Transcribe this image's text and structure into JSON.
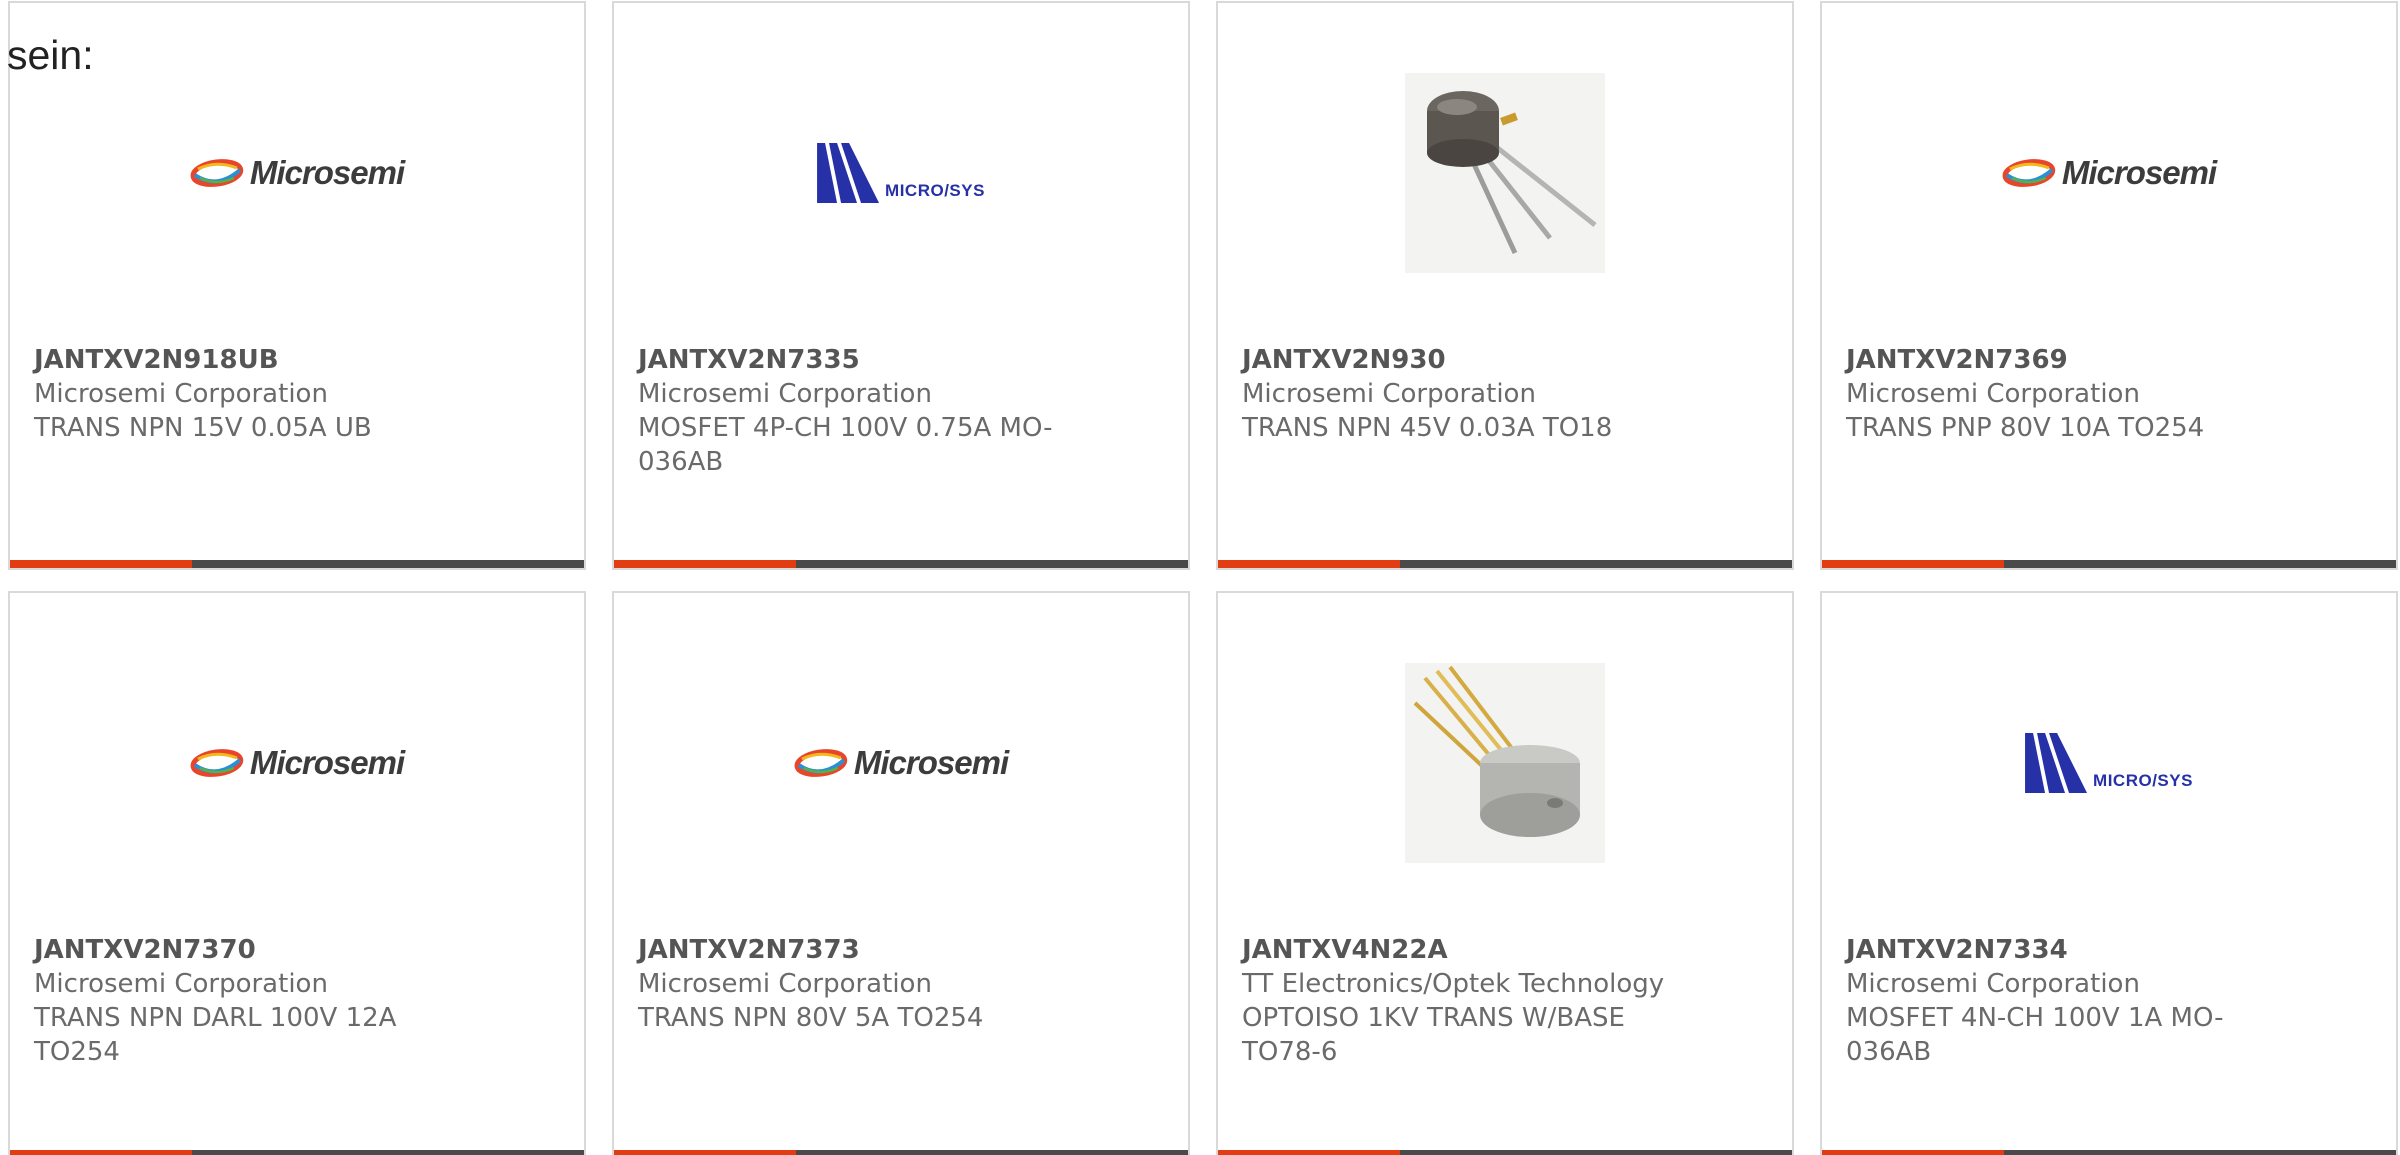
{
  "intro_text": "sein:",
  "colors": {
    "accent": "#e23d12",
    "bar": "#4a4a4a",
    "border": "#d9d9d9",
    "text": "#6a6a6a",
    "microsys_blue": "#2631a8"
  },
  "products": [
    {
      "part_number": "JANTXV2N918UB",
      "manufacturer": "Microsemi Corporation",
      "description": "TRANS NPN 15V 0.05A UB",
      "image": "microsemi-logo",
      "logo_text": "Microsemi"
    },
    {
      "part_number": "JANTXV2N7335",
      "manufacturer": "Microsemi Corporation",
      "description": "MOSFET 4P-CH 100V 0.75A MO-036AB",
      "image": "microsys-logo",
      "logo_text": "MICRO/SYS"
    },
    {
      "part_number": "JANTXV2N930",
      "manufacturer": "Microsemi Corporation",
      "description": "TRANS NPN 45V 0.03A TO18",
      "image": "to18-transistor-photo",
      "logo_text": ""
    },
    {
      "part_number": "JANTXV2N7369",
      "manufacturer": "Microsemi Corporation",
      "description": "TRANS PNP 80V 10A TO254",
      "image": "microsemi-logo",
      "logo_text": "Microsemi"
    },
    {
      "part_number": "JANTXV2N7370",
      "manufacturer": "Microsemi Corporation",
      "description": "TRANS NPN DARL 100V 12A TO254",
      "image": "microsemi-logo",
      "logo_text": "Microsemi"
    },
    {
      "part_number": "JANTXV2N7373",
      "manufacturer": "Microsemi Corporation",
      "description": "TRANS NPN 80V 5A TO254",
      "image": "microsemi-logo",
      "logo_text": "Microsemi"
    },
    {
      "part_number": "JANTXV4N22A",
      "manufacturer": "TT Electronics/Optek Technology",
      "description": "OPTOISO 1KV TRANS W/BASE TO78-6",
      "image": "to78-optoisolator-photo",
      "logo_text": ""
    },
    {
      "part_number": "JANTXV2N7334",
      "manufacturer": "Microsemi Corporation",
      "description": "MOSFET 4N-CH 100V 1A MO-036AB",
      "image": "microsys-logo",
      "logo_text": "MICRO/SYS"
    }
  ]
}
